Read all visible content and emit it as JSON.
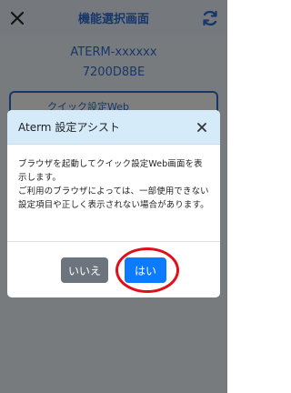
{
  "header": {
    "title": "機能選択画面",
    "close_icon": "close-icon",
    "refresh_icon": "refresh-icon"
  },
  "device": {
    "name": "ATERM-xxxxxx",
    "id": "7200D8BE"
  },
  "background_card": {
    "label": "クイック設定Web"
  },
  "dialog": {
    "title": "Aterm 設定アシスト",
    "message": "ブラウザを起動してクイック設定Web画面を表示します。\nご利用のブラウザによっては、一部使用できない設定項目や正しく表示されない場合があります。",
    "no_label": "いいえ",
    "yes_label": "はい"
  },
  "colors": {
    "accent": "#2e6fd6",
    "primary_button": "#0d7bff",
    "secondary_button": "#6c757d",
    "highlight": "#e0101a",
    "dialog_header": "#d6ebfa"
  }
}
